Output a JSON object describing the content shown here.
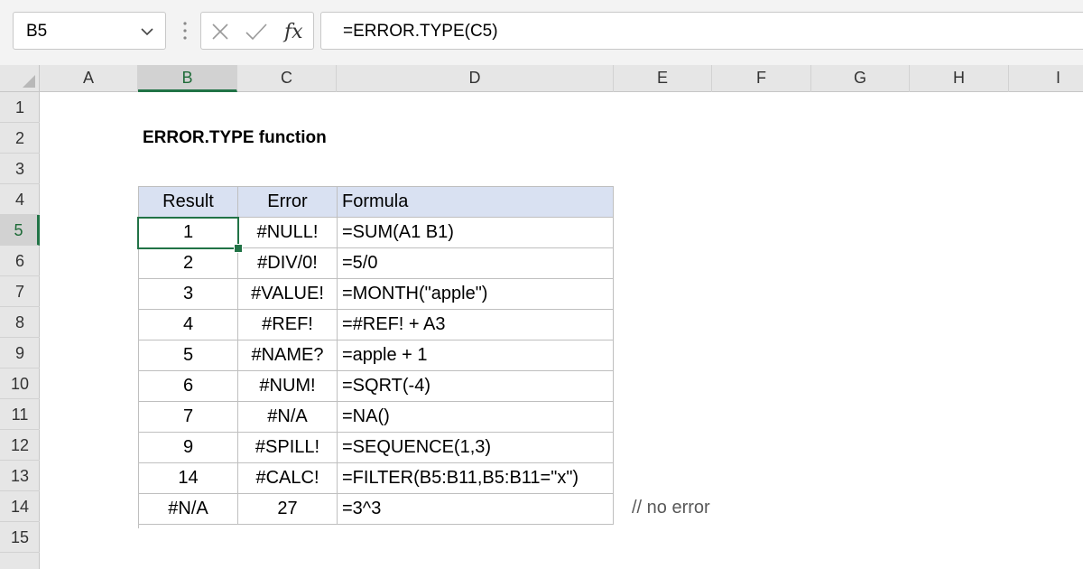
{
  "name_box": {
    "value": "B5"
  },
  "formula_bar": {
    "value": "=ERROR.TYPE(C5)"
  },
  "columns": [
    "A",
    "B",
    "C",
    "D",
    "E",
    "F",
    "G",
    "H",
    "I"
  ],
  "active_column": "B",
  "rows": [
    "1",
    "2",
    "3",
    "4",
    "5",
    "6",
    "7",
    "8",
    "9",
    "10",
    "11",
    "12",
    "13",
    "14",
    "15"
  ],
  "active_row": "5",
  "sheet_title": "ERROR.TYPE function",
  "table": {
    "headers": [
      "Result",
      "Error",
      "Formula"
    ],
    "rows": [
      [
        "1",
        "#NULL!",
        "=SUM(A1 B1)"
      ],
      [
        "2",
        "#DIV/0!",
        "=5/0"
      ],
      [
        "3",
        "#VALUE!",
        "=MONTH(\"apple\")"
      ],
      [
        "4",
        "#REF!",
        "=#REF! + A3"
      ],
      [
        "5",
        "#NAME?",
        "=apple + 1"
      ],
      [
        "6",
        "#NUM!",
        "=SQRT(-4)"
      ],
      [
        "7",
        "#N/A",
        "=NA()"
      ],
      [
        "9",
        "#SPILL!",
        "=SEQUENCE(1,3)"
      ],
      [
        "14",
        "#CALC!",
        "=FILTER(B5:B11,B5:B11=\"x\")"
      ],
      [
        "#N/A",
        "27",
        "=3^3"
      ]
    ]
  },
  "note": "// no error",
  "colors": {
    "accent": "#217346",
    "header_fill": "#d9e1f2"
  },
  "icons": [
    "chevron-down-icon",
    "more-dots-icon",
    "cancel-x-icon",
    "enter-check-icon",
    "insert-function-icon"
  ]
}
